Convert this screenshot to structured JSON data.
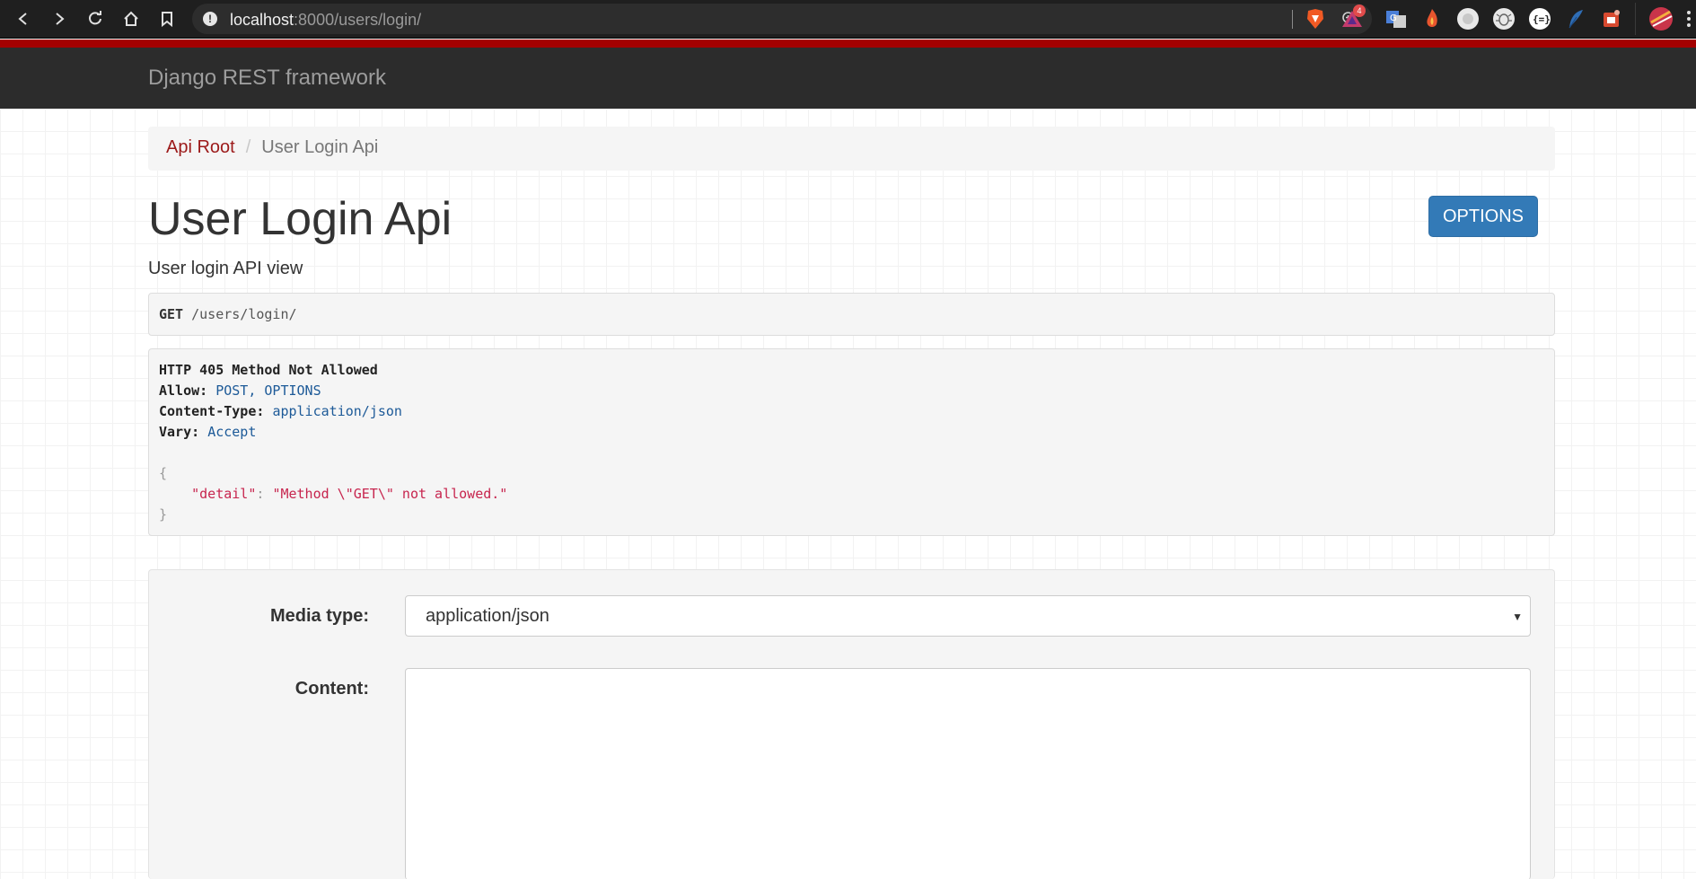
{
  "browser": {
    "url_host": "localhost",
    "url_path": ":8000/users/login/",
    "security_icon": "info-icon",
    "extensions": [
      {
        "name": "brave-shield-icon",
        "color": "#f15a24"
      },
      {
        "name": "brave-rewards-icon",
        "color": "#c43b6d",
        "badge": "4"
      },
      {
        "name": "translate-icon",
        "color": "#4a7fd8"
      },
      {
        "name": "fire-extension-icon",
        "color": "#e8552e"
      },
      {
        "name": "white-circle-extension-icon",
        "color": "#e8e8e8"
      },
      {
        "name": "bug-extension-icon",
        "color": "#e8e8e8"
      },
      {
        "name": "json-extension-icon",
        "color": "#ffffff"
      },
      {
        "name": "feather-extension-icon",
        "color": "#2f6db5"
      },
      {
        "name": "tag-extension-icon",
        "color": "#d84a30"
      }
    ]
  },
  "navbar": {
    "brand": "Django REST framework"
  },
  "breadcrumb": {
    "root": "Api Root",
    "separator": "/",
    "current": "User Login Api"
  },
  "page": {
    "title": "User Login Api",
    "description": "User login API view",
    "options_label": "OPTIONS"
  },
  "request": {
    "method": "GET",
    "path": "/users/login/"
  },
  "response": {
    "status": "HTTP 405 Method Not Allowed",
    "headers": [
      {
        "key": "Allow:",
        "value": "POST, OPTIONS"
      },
      {
        "key": "Content-Type:",
        "value": "application/json"
      },
      {
        "key": "Vary:",
        "value": "Accept"
      }
    ],
    "open_brace": "{",
    "json_key": "\"detail\"",
    "json_colon": ": ",
    "json_value": "\"Method \\\"GET\\\" not allowed.\"",
    "close_brace": "}"
  },
  "form": {
    "media_type_label": "Media type:",
    "media_type_value": "application/json",
    "content_label": "Content:",
    "content_value": ""
  },
  "colors": {
    "accent_red": "#a30000",
    "navbar_bg": "#2c2c2c",
    "button_blue": "#337ab7",
    "link_red": "#9c1a1a"
  }
}
